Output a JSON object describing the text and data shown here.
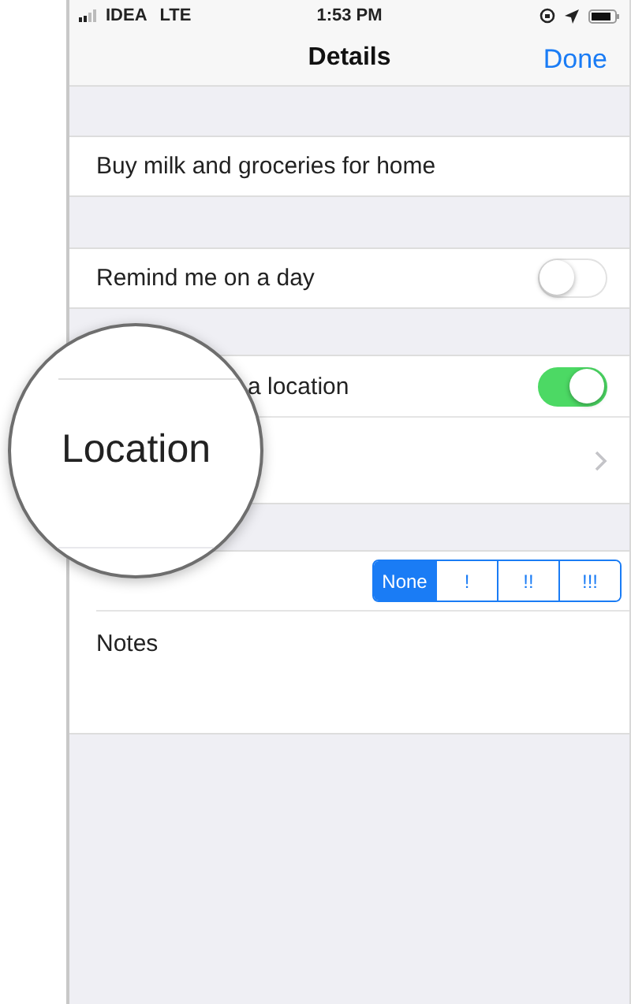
{
  "status_bar": {
    "carrier": "IDEA",
    "network": "LTE",
    "time": "1:53 PM"
  },
  "nav": {
    "title": "Details",
    "action": "Done"
  },
  "title_field": {
    "value": "Buy milk and groceries for home"
  },
  "day_toggle": {
    "label": "Remind me on a day",
    "on": false
  },
  "location_toggle": {
    "label": "a location",
    "on": true
  },
  "priority": {
    "options": [
      {
        "label": "None",
        "selected": true
      },
      {
        "label": "!",
        "selected": false
      },
      {
        "label": "!!",
        "selected": false
      },
      {
        "label": "!!!",
        "selected": false
      }
    ]
  },
  "notes": {
    "placeholder": "Notes"
  },
  "magnifier": {
    "label": "Location"
  }
}
